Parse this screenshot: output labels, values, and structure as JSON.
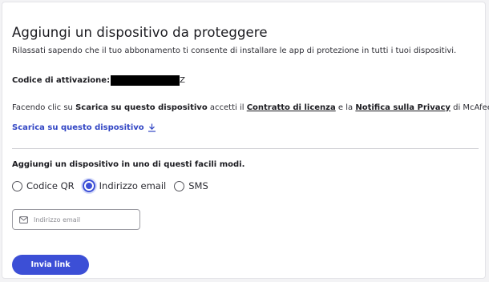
{
  "page": {
    "title": "Aggiungi un dispositivo da proteggere",
    "subtitle": "Rilassati sapendo che il tuo abbonamento ti consente di installare le app di protezione in tutti i tuoi dispositivi."
  },
  "activation": {
    "label": "Codice di attivazione:",
    "code_suffix": "Z"
  },
  "license": {
    "prefix": "Facendo clic su ",
    "download_bold": "Scarica su questo dispositivo",
    "middle": " accetti il ",
    "contract_link": "Contratto di licenza",
    "and": " e la ",
    "privacy_link": "Notifica sulla Privacy",
    "suffix": " di McAfee."
  },
  "download": {
    "label": "Scarica su questo dispositivo",
    "icon": "download-icon"
  },
  "methods": {
    "title": "Aggiungi un dispositivo in uno di questi facili modi.",
    "options": [
      {
        "label": "Codice QR",
        "selected": false
      },
      {
        "label": "Indirizzo email",
        "selected": true
      },
      {
        "label": "SMS",
        "selected": false
      }
    ]
  },
  "email": {
    "placeholder": "Indirizzo email",
    "value": "",
    "icon": "mail-icon"
  },
  "submit": {
    "label": "Invia link"
  },
  "colors": {
    "accent": "#3c4fd6",
    "link": "#3246c4"
  }
}
